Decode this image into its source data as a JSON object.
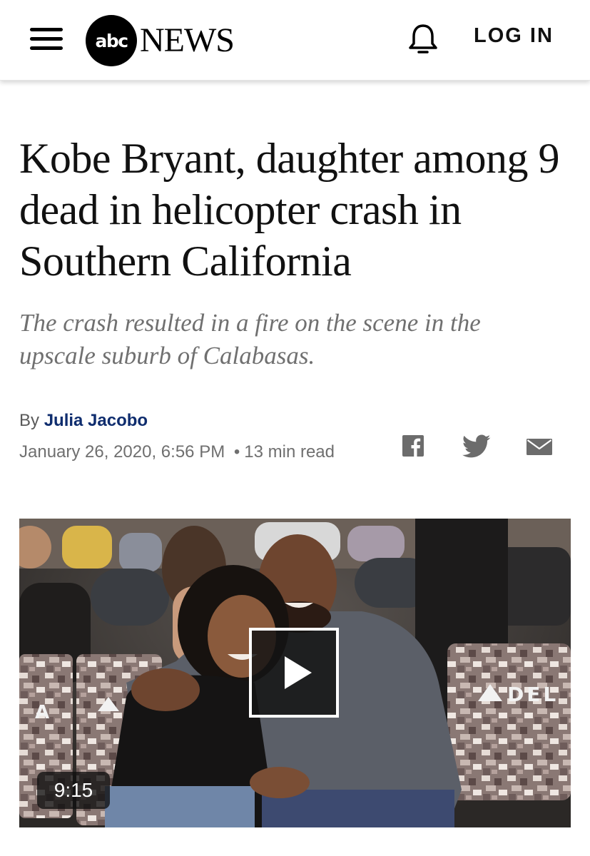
{
  "header": {
    "logo_abc": "abc",
    "logo_news": "NEWS",
    "menu_icon": "hamburger-menu-icon",
    "notification_icon": "bell-icon",
    "login_label": "LOG IN"
  },
  "article": {
    "headline": "Kobe Bryant, daughter among 9 dead in helicopter crash in Southern California",
    "subheadline": "The crash resulted in a fire on the scene in the upscale suburb of Calabasas.",
    "byline_prefix": "By",
    "author": "Julia Jacobo",
    "date": "January 26, 2020, 6:56 PM",
    "separator": "•",
    "read_time": "13 min read",
    "share": [
      {
        "name": "facebook",
        "icon": "facebook-icon"
      },
      {
        "name": "twitter",
        "icon": "twitter-icon"
      },
      {
        "name": "email",
        "icon": "email-icon"
      }
    ]
  },
  "video": {
    "duration": "9:15",
    "play_icon": "play-icon",
    "seat_cover_text": "DEL",
    "seat_cover_letter": "A"
  },
  "colors": {
    "author_link": "#0f2d6e",
    "subhead_gray": "#707070",
    "meta_gray": "#6f6f6f",
    "share_icon_gray": "#6c6c6c"
  }
}
